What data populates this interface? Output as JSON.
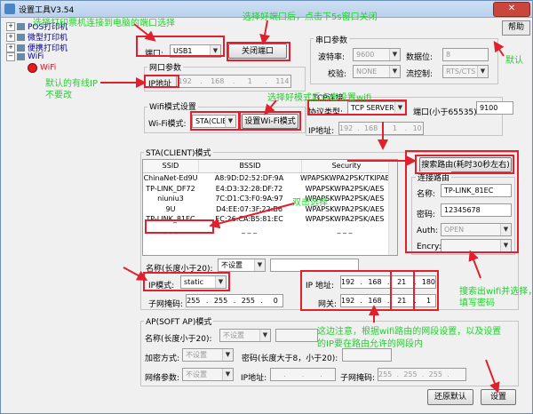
{
  "window": {
    "title": "设置工具V3.54",
    "help_label": "帮助",
    "close_glyph": "✕"
  },
  "tree": {
    "items": [
      {
        "label": "POS打印机"
      },
      {
        "label": "微型打印机"
      },
      {
        "label": "便携打印机"
      },
      {
        "label": "WiFi"
      },
      {
        "label": "WiFi"
      }
    ]
  },
  "port": {
    "label": "端口:",
    "value": "USB1",
    "close_button": "关闭端口"
  },
  "net_params": {
    "group": "网口参数",
    "ip_label": "IP地址",
    "ip": [
      "192",
      "168",
      "1",
      "114"
    ]
  },
  "serial": {
    "group": "串口参数",
    "baud_label": "波特率:",
    "baud": "9600",
    "data_bits_label": "数据位:",
    "data_bits": "8",
    "parity_label": "校验:",
    "parity": "NONE",
    "flow_label": "流控制:",
    "flow": "RTS/CTS"
  },
  "wifi_mode": {
    "group": "Wifi模式设置",
    "label": "Wi-Fi模式:",
    "value": "STA(CLIE",
    "set_button": "设置Wi-Fi模式"
  },
  "protocol": {
    "group": "TCP连接",
    "type_label": "协议类型:",
    "type": "TCP SERVER",
    "port_label": "端口(小于65535):",
    "port": "9100",
    "ip_label": "IP地址:",
    "ip": [
      "192",
      "168",
      "1",
      "10"
    ]
  },
  "sta": {
    "group": "STA(CLIENT)模式",
    "columns": [
      "SSID",
      "BSSID",
      "Security"
    ],
    "rows": [
      [
        "ChinaNet-Ed9U",
        "A8:9D:D2:52:DF:9A",
        "WPAPSKWPA2PSK/TKIPAES"
      ],
      [
        "TP-LINK_DF72",
        "E4:D3:32:28:DF:72",
        "WPAPSKWPA2PSK/AES"
      ],
      [
        "niuniu3",
        "7C:D1:C3:F0:9A:97",
        "WPAPSKWPA2PSK/AES"
      ],
      [
        "9U",
        "D4:EE:07:3F:22:B6",
        "WPAPSKWPA2PSK/AES"
      ],
      [
        "TP-LINK_81EC",
        "EC:26:CA:B5:81:EC",
        "WPAPSKWPA2PSK/AES"
      ],
      [
        "_ _ _",
        "_ _ _",
        "_ _ _"
      ]
    ],
    "search_button": "搜索路由(耗时30秒左右)",
    "conn_group": "连接路由",
    "name_label": "名称:",
    "name": "TP-LINK_81EC",
    "pwd_label": "密码:",
    "pwd": "12345678",
    "auth_label": "Auth:",
    "auth": "OPEN",
    "encry_label": "Encry:",
    "encry": ""
  },
  "name_len": {
    "label": "名称(长度小于20):",
    "value": "不设置"
  },
  "ip_mode": {
    "label": "IP模式:",
    "value": "static"
  },
  "subnet": {
    "label": "子网掩码:",
    "value": [
      "255",
      "255",
      "255",
      "0"
    ]
  },
  "ip_addr": {
    "label": "IP 地址:",
    "value": [
      "192",
      "168",
      "21",
      "180"
    ]
  },
  "gateway": {
    "label": "网关:",
    "value": [
      "192",
      "168",
      "21",
      "1"
    ]
  },
  "ap": {
    "group": "AP(SOFT AP)模式",
    "name_label": "名称(长度小于20):",
    "name": "不设置",
    "enc_label": "加密方式:",
    "enc": "不设置",
    "pwd_label": "密码(长度大于8，小于20):",
    "netparam_label": "网络参数:",
    "netparam": "不设置",
    "ip_label": "IP地址:",
    "mask_label": "子网掩码:",
    "mask": [
      "255",
      "255",
      "255",
      ""
    ]
  },
  "buttons": {
    "restore": "还原默认",
    "set": "设置"
  },
  "annotations": {
    "a1": "选择打印票机连接到电脑的端口选择",
    "a2": "选择好端口后，点击下5s窗口关闭",
    "a3": "默认",
    "a4": "默认的有线IP",
    "a4b": "不要改",
    "a5": "选择好模式后点击设置wifi",
    "a6": "双击选择",
    "a7": "搜索出wifi并选择，",
    "a7b": "填写密码",
    "a8": "这边注意，根据wifi路由的网段设置，以及设置",
    "a8b": "的IP要在路由允许的网段内"
  },
  "colors": {
    "annotation": "#1ed32a",
    "highlight": "#e0202c"
  }
}
